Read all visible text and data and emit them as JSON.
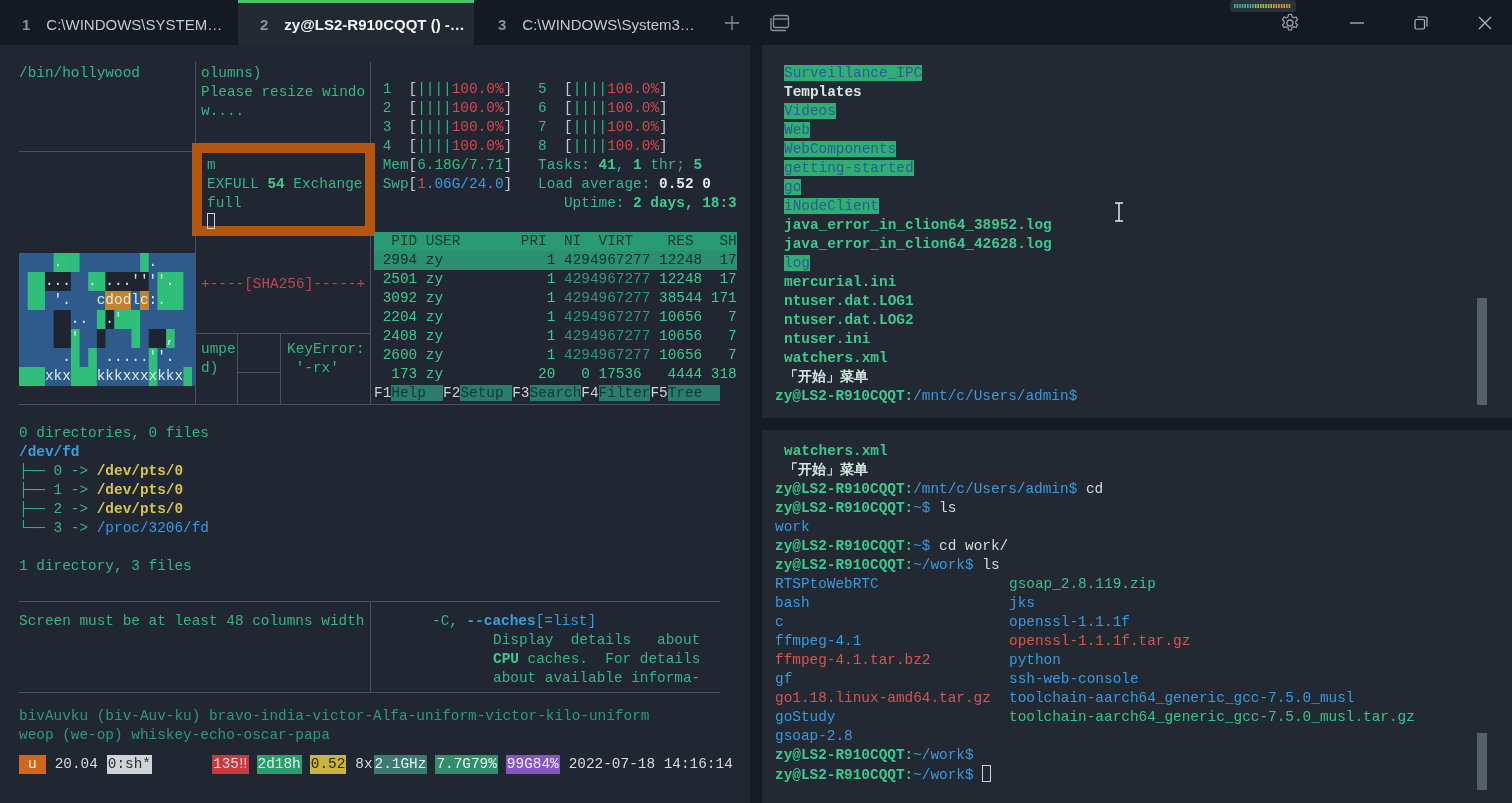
{
  "tabs": [
    {
      "number": "1",
      "title": "C:\\WINDOWS\\SYSTEM…",
      "selected": false
    },
    {
      "number": "2",
      "title": "zy@LS2-R910CQQT () -…",
      "selected": true
    },
    {
      "number": "3",
      "title": "C:\\WINDOWS\\System3…",
      "selected": false
    }
  ],
  "left": {
    "hollywood": [
      {
        "segs": [
          {
            "text": "/bin/hollywood",
            "kind": "prose"
          }
        ]
      }
    ],
    "resize": [
      {
        "segs": [
          {
            "text": "olumns)",
            "kind": "prose"
          }
        ]
      },
      {
        "segs": [
          {
            "text": "Please resize windo",
            "kind": "prose"
          }
        ]
      },
      {
        "segs": [
          {
            "text": "w....",
            "kind": "prose"
          }
        ]
      }
    ],
    "boxed": [
      {
        "segs": [
          {
            "text": "m",
            "kind": "prose"
          }
        ]
      },
      {
        "segs": [
          {
            "text": "EXFULL ",
            "kind": "prose"
          },
          {
            "text": "54",
            "kind": "bold"
          },
          {
            "text": " Exchange",
            "kind": "prose"
          }
        ]
      },
      {
        "segs": [
          {
            "text": "full",
            "kind": "prose"
          }
        ]
      }
    ],
    "art_lines": [
      "    .          .",
      "   ...  . ...''''.",
      "    '.   cdodlc:.",
      "      ..  .'",
      "      '          ,",
      "     .    .....''.",
      "   xkx   kkkxxxxkkx"
    ],
    "sha": {
      "segs": [
        {
          "text": "+----[SHA256]-----+",
          "kind": "sha"
        }
      ]
    },
    "umped": [
      {
        "segs": [
          {
            "text": "umpe",
            "kind": "prose"
          }
        ]
      },
      {
        "segs": [
          {
            "text": "d)",
            "kind": "prose"
          }
        ]
      }
    ],
    "keyerror": [
      {
        "segs": [
          {
            "text": "KeyError:",
            "kind": "prose"
          }
        ]
      },
      {
        "segs": [
          {
            "text": " '-rx'",
            "kind": "prose"
          }
        ]
      }
    ],
    "htop": {
      "meters": [
        {
          "segs": [
            {
              "text": " 1  ",
              "kind": "num"
            },
            {
              "text": "[",
              "kind": "br"
            },
            {
              "text": "||||",
              "kind": "bar"
            },
            {
              "text": "100.0%",
              "kind": "red"
            },
            {
              "text": "]",
              "kind": "br"
            },
            {
              "text": "   5  ",
              "kind": "num"
            },
            {
              "text": "[",
              "kind": "br"
            },
            {
              "text": "||||",
              "kind": "bar"
            },
            {
              "text": "100.0%",
              "kind": "red"
            },
            {
              "text": "]",
              "kind": "br"
            }
          ]
        },
        {
          "segs": [
            {
              "text": " 2  ",
              "kind": "num"
            },
            {
              "text": "[",
              "kind": "br"
            },
            {
              "text": "||||",
              "kind": "bar"
            },
            {
              "text": "100.0%",
              "kind": "red"
            },
            {
              "text": "]",
              "kind": "br"
            },
            {
              "text": "   6  ",
              "kind": "num"
            },
            {
              "text": "[",
              "kind": "br"
            },
            {
              "text": "||||",
              "kind": "bar"
            },
            {
              "text": "100.0%",
              "kind": "red"
            },
            {
              "text": "]",
              "kind": "br"
            }
          ]
        },
        {
          "segs": [
            {
              "text": " 3  ",
              "kind": "num"
            },
            {
              "text": "[",
              "kind": "br"
            },
            {
              "text": "||||",
              "kind": "bar"
            },
            {
              "text": "100.0%",
              "kind": "red"
            },
            {
              "text": "]",
              "kind": "br"
            },
            {
              "text": "   7  ",
              "kind": "num"
            },
            {
              "text": "[",
              "kind": "br"
            },
            {
              "text": "||||",
              "kind": "bar"
            },
            {
              "text": "100.0%",
              "kind": "red"
            },
            {
              "text": "]",
              "kind": "br"
            }
          ]
        },
        {
          "segs": [
            {
              "text": " 4  ",
              "kind": "num"
            },
            {
              "text": "[",
              "kind": "br"
            },
            {
              "text": "||||",
              "kind": "bar"
            },
            {
              "text": "100.0%",
              "kind": "red"
            },
            {
              "text": "]",
              "kind": "br"
            },
            {
              "text": "   8  ",
              "kind": "num"
            },
            {
              "text": "[",
              "kind": "br"
            },
            {
              "text": "||||",
              "kind": "bar"
            },
            {
              "text": "100.0%",
              "kind": "red"
            },
            {
              "text": "]",
              "kind": "br"
            }
          ]
        },
        {
          "segs": [
            {
              "text": " Mem",
              "kind": "num"
            },
            {
              "text": "[",
              "kind": "br"
            },
            {
              "text": "6.18G/7.71",
              "kind": "bar"
            },
            {
              "text": "]",
              "kind": "br"
            },
            {
              "text": "   Tasks: ",
              "kind": "num"
            },
            {
              "text": "41",
              "kind": "bold"
            },
            {
              "text": ", ",
              "kind": "num"
            },
            {
              "text": "1",
              "kind": "bold"
            },
            {
              "text": " thr; ",
              "kind": "num"
            },
            {
              "text": "5",
              "kind": "bold"
            }
          ]
        },
        {
          "segs": [
            {
              "text": " Swp",
              "kind": "num"
            },
            {
              "text": "[",
              "kind": "br"
            },
            {
              "text": "1",
              "kind": "red"
            },
            {
              "text": ".06G/24.0",
              "kind": "path"
            },
            {
              "text": "]",
              "kind": "br"
            },
            {
              "text": "   Load average: ",
              "kind": "num"
            },
            {
              "text": "0.52 0",
              "kind": "val"
            }
          ]
        },
        {
          "segs": [
            {
              "text": "                      Uptime: ",
              "kind": "num"
            },
            {
              "text": "2 days, 18:3",
              "kind": "bold"
            }
          ]
        }
      ],
      "header": {
        "segs": [
          {
            "text": "  PID USER       PRI  NI  VIRT    RES   SH",
            "kind": "hdr"
          }
        ]
      },
      "rows": [
        {
          "selected": true,
          "segs": [
            {
              "text": " 2994 zy            1 ",
              "kind": "proc"
            },
            {
              "text": "4294967277",
              "kind": "dim"
            },
            {
              "text": " 12248  17",
              "kind": "proc"
            }
          ]
        },
        {
          "selected": false,
          "segs": [
            {
              "text": " 2501 zy            1 ",
              "kind": "proc"
            },
            {
              "text": "4294967277",
              "kind": "dim"
            },
            {
              "text": " 12248  17",
              "kind": "proc"
            }
          ]
        },
        {
          "selected": false,
          "segs": [
            {
              "text": " 3092 zy            1 ",
              "kind": "proc"
            },
            {
              "text": "4294967277",
              "kind": "dim"
            },
            {
              "text": " 38544 171",
              "kind": "proc"
            }
          ]
        },
        {
          "selected": false,
          "segs": [
            {
              "text": " 2204 zy            1 ",
              "kind": "proc"
            },
            {
              "text": "4294967277",
              "kind": "dim"
            },
            {
              "text": " 10656   7",
              "kind": "proc"
            }
          ]
        },
        {
          "selected": false,
          "segs": [
            {
              "text": " 2408 zy            1 ",
              "kind": "proc"
            },
            {
              "text": "4294967277",
              "kind": "dim"
            },
            {
              "text": " 10656   7",
              "kind": "proc"
            }
          ]
        },
        {
          "selected": false,
          "segs": [
            {
              "text": " 2600 zy            1 ",
              "kind": "proc"
            },
            {
              "text": "4294967277",
              "kind": "dim"
            },
            {
              "text": " 10656   7",
              "kind": "proc"
            }
          ]
        },
        {
          "selected": false,
          "segs": [
            {
              "text": "  173 zy           20   0 17536   4444 318",
              "kind": "proc"
            }
          ]
        }
      ],
      "fkeys": {
        "segs": [
          {
            "text": "F1",
            "kind": "fkey"
          },
          {
            "text": "Help  ",
            "kind": "flabel"
          },
          {
            "text": "F2",
            "kind": "fkey"
          },
          {
            "text": "Setup ",
            "kind": "flabel"
          },
          {
            "text": "F3",
            "kind": "fkey"
          },
          {
            "text": "Search",
            "kind": "flabel"
          },
          {
            "text": "F4",
            "kind": "fkey"
          },
          {
            "text": "Filter",
            "kind": "flabel"
          },
          {
            "text": "F5",
            "kind": "fkey"
          },
          {
            "text": "Tree  ",
            "kind": "flabel"
          }
        ]
      }
    },
    "tree": [
      {
        "segs": [
          {
            "text": "0 directories, 0 files",
            "kind": "prose"
          }
        ]
      },
      {
        "segs": [
          {
            "text": "/dev/fd",
            "kind": "dir"
          }
        ]
      },
      {
        "segs": [
          {
            "text": "├── 0 -> ",
            "kind": "prose"
          },
          {
            "text": "/dev/pts/0",
            "kind": "link"
          }
        ]
      },
      {
        "segs": [
          {
            "text": "├── 1 -> ",
            "kind": "prose"
          },
          {
            "text": "/dev/pts/0",
            "kind": "link"
          }
        ]
      },
      {
        "segs": [
          {
            "text": "├── 2 -> ",
            "kind": "prose"
          },
          {
            "text": "/dev/pts/0",
            "kind": "link"
          }
        ]
      },
      {
        "segs": [
          {
            "text": "└── 3 -> ",
            "kind": "prose"
          },
          {
            "text": "/proc/3206/fd",
            "kind": "path"
          }
        ]
      }
    ],
    "tree_summary": {
      "segs": [
        {
          "text": "1 directory, 3 files",
          "kind": "prose"
        }
      ]
    },
    "screen_msg": {
      "segs": [
        {
          "text": "Screen must be at least 48 columns width",
          "kind": "prose"
        }
      ]
    },
    "caches": [
      {
        "segs": [
          {
            "text": "-C, ",
            "kind": "prose"
          },
          {
            "text": "--caches",
            "kind": "dir"
          },
          {
            "text": "[=list]",
            "kind": "path"
          }
        ]
      },
      {
        "segs": [
          {
            "text": "Display  details   about",
            "kind": "prose"
          }
        ]
      },
      {
        "segs": [
          {
            "text": "CPU",
            "kind": "bold"
          },
          {
            "text": " caches.  For details",
            "kind": "prose"
          }
        ]
      },
      {
        "segs": [
          {
            "text": "about available informa-",
            "kind": "prose"
          }
        ]
      }
    ],
    "nato": [
      {
        "segs": [
          {
            "text": "bivAuvku (biv-Auv-ku) bravo-india-victor-Alfa-uniform-victor-kilo-uniform",
            "kind": "dim"
          }
        ]
      },
      {
        "segs": [
          {
            "text": "weop (we-op) whiskey-echo-oscar-papa",
            "kind": "dim"
          }
        ]
      }
    ],
    "status_bar": [
      {
        "text": "u",
        "kind": "session"
      },
      {
        "text": "20.04",
        "kind": "plain"
      },
      {
        "text": "0:sh*",
        "kind": "window"
      },
      {
        "text": "135‼",
        "kind": "alert"
      },
      {
        "text": "2d18h",
        "kind": "uptime"
      },
      {
        "text": "0.52",
        "kind": "load"
      },
      {
        "text": "8x",
        "kind": "plain"
      },
      {
        "text": "2.1GHz",
        "kind": "cpu"
      },
      {
        "text": "7.7G79%",
        "kind": "mem"
      },
      {
        "text": "99G84%",
        "kind": "disk"
      },
      {
        "text": "2022-07-18 14:16:14",
        "kind": "plain"
      }
    ]
  },
  "right_top": [
    {
      "segs": [
        {
          "text": "Surveillance_IPC",
          "kind": "hl"
        }
      ]
    },
    {
      "segs": [
        {
          "text": "Templates",
          "kind": "title"
        }
      ]
    },
    {
      "segs": [
        {
          "text": "Videos",
          "kind": "hl"
        }
      ]
    },
    {
      "segs": [
        {
          "text": "Web",
          "kind": "hl"
        }
      ]
    },
    {
      "segs": [
        {
          "text": "WebComponents",
          "kind": "hl"
        }
      ]
    },
    {
      "segs": [
        {
          "text": "getting-started",
          "kind": "hl"
        }
      ]
    },
    {
      "segs": [
        {
          "text": "go",
          "kind": "hl"
        }
      ]
    },
    {
      "segs": [
        {
          "text": "iNodeClient",
          "kind": "hl"
        }
      ]
    },
    {
      "segs": [
        {
          "text": "java_error_in_clion64_38952.log",
          "kind": "file"
        }
      ]
    },
    {
      "segs": [
        {
          "text": "java_error_in_clion64_42628.log",
          "kind": "file"
        }
      ]
    },
    {
      "segs": [
        {
          "text": "log",
          "kind": "hl"
        }
      ]
    },
    {
      "segs": [
        {
          "text": "mercurial.ini",
          "kind": "file"
        }
      ]
    },
    {
      "segs": [
        {
          "text": "ntuser.dat.LOG1",
          "kind": "file"
        }
      ]
    },
    {
      "segs": [
        {
          "text": "ntuser.dat.LOG2",
          "kind": "file"
        }
      ]
    },
    {
      "segs": [
        {
          "text": "ntuser.ini",
          "kind": "file"
        }
      ]
    },
    {
      "segs": [
        {
          "text": "watchers.xml",
          "kind": "file"
        }
      ]
    },
    {
      "segs": [
        {
          "text": "「开始」菜单",
          "kind": "title"
        }
      ]
    },
    {
      "segs": [
        {
          "text": "zy@LS2-R910CQQT:",
          "kind": "user"
        },
        {
          "text": "/mnt/c/Users/admin$",
          "kind": "path"
        }
      ]
    }
  ],
  "right_bottom": {
    "lines": [
      {
        "segs": [
          {
            "text": "watchers.xml",
            "kind": "file"
          }
        ]
      },
      {
        "segs": [
          {
            "text": "「开始」菜单",
            "kind": "title"
          }
        ]
      },
      {
        "segs": [
          {
            "text": "zy@LS2-R910CQQT:",
            "kind": "user"
          },
          {
            "text": "/mnt/c/Users/admin$",
            "kind": "path"
          },
          {
            "text": " cd",
            "kind": "cmd"
          }
        ]
      },
      {
        "segs": [
          {
            "text": "zy@LS2-R910CQQT:",
            "kind": "user"
          },
          {
            "text": "~$",
            "kind": "path"
          },
          {
            "text": " ls",
            "kind": "cmd"
          }
        ]
      },
      {
        "segs": [
          {
            "text": "work",
            "kind": "path"
          }
        ]
      },
      {
        "segs": [
          {
            "text": "zy@LS2-R910CQQT:",
            "kind": "user"
          },
          {
            "text": "~$",
            "kind": "path"
          },
          {
            "text": " cd work/",
            "kind": "cmd"
          }
        ]
      },
      {
        "segs": [
          {
            "text": "zy@LS2-R910CQQT:",
            "kind": "user"
          },
          {
            "text": "~/work$",
            "kind": "path"
          },
          {
            "text": " ls",
            "kind": "cmd"
          }
        ]
      }
    ],
    "listing": [
      [
        {
          "text": "RTSPtoWebRTC",
          "kind": "path"
        },
        {
          "text": "gsoap_2.8.119.zip",
          "kind": "exe"
        }
      ],
      [
        {
          "text": "bash",
          "kind": "path"
        },
        {
          "text": "jks",
          "kind": "path"
        }
      ],
      [
        {
          "text": "c",
          "kind": "path"
        },
        {
          "text": "openssl-1.1.1f",
          "kind": "path"
        }
      ],
      [
        {
          "text": "ffmpeg-4.1",
          "kind": "path"
        },
        {
          "text": "openssl-1.1.1f.tar.gz",
          "kind": "err"
        }
      ],
      [
        {
          "text": "ffmpeg-4.1.tar.bz2",
          "kind": "err"
        },
        {
          "text": "python",
          "kind": "path"
        }
      ],
      [
        {
          "text": "gf",
          "kind": "path"
        },
        {
          "text": "ssh-web-console",
          "kind": "path"
        }
      ],
      [
        {
          "text": "go1.18.linux-amd64.tar.gz",
          "kind": "err"
        },
        {
          "text": "toolchain-aarch64_generic_gcc-7.5.0_musl",
          "kind": "path"
        }
      ],
      [
        {
          "text": "goStudy",
          "kind": "path"
        },
        {
          "text": "toolchain-aarch64_generic_gcc-7.5.0_musl.tar.gz",
          "kind": "exe"
        }
      ],
      [
        {
          "text": "gsoap-2.8",
          "kind": "path"
        }
      ]
    ],
    "after": [
      {
        "segs": [
          {
            "text": "zy@LS2-R910CQQT:",
            "kind": "user"
          },
          {
            "text": "~/work$",
            "kind": "path"
          }
        ]
      },
      {
        "segs": [
          {
            "text": "zy@LS2-R910CQQT:",
            "kind": "user"
          },
          {
            "text": "~/work$",
            "kind": "path"
          }
        ]
      }
    ]
  }
}
